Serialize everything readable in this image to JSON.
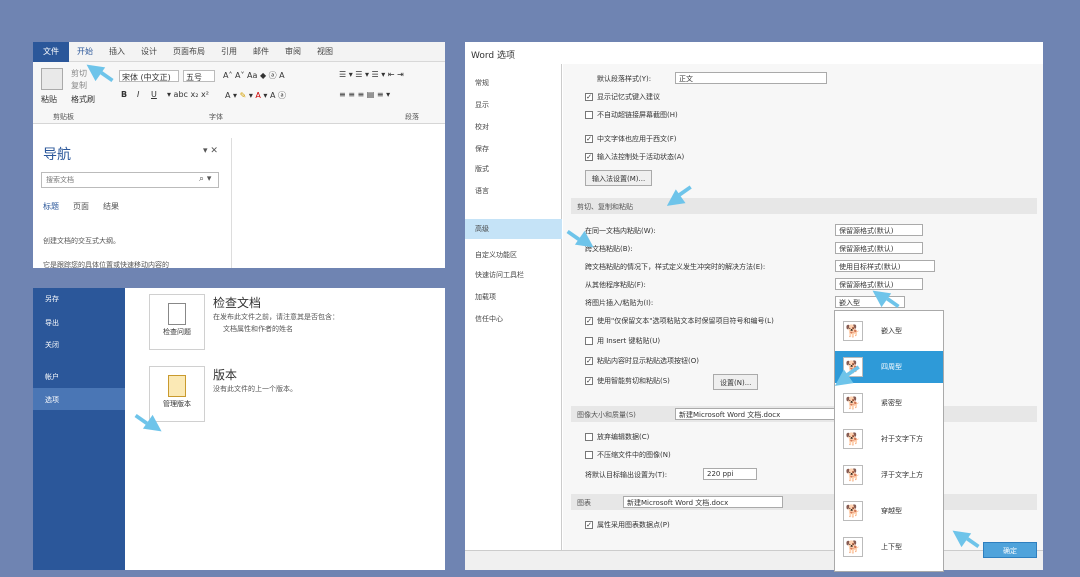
{
  "ribbon": {
    "tabs": [
      "文件",
      "开始",
      "插入",
      "设计",
      "页面布局",
      "引用",
      "邮件",
      "审阅",
      "视图"
    ],
    "paste": "粘贴",
    "cut": "剪切",
    "copy": "复制",
    "format_painter": "格式刷",
    "font_name": "宋体 (中文正)",
    "font_size": "五号",
    "groups": [
      "剪贴板",
      "字体",
      "段落"
    ]
  },
  "nav": {
    "title": "导航",
    "search_placeholder": "搜索文档",
    "tabs": [
      "标题",
      "页面",
      "结果"
    ],
    "text1": "创建文档的交互式大纲。",
    "text2": "它是跟踪您的具体位置或快速移动内容的"
  },
  "backstage": {
    "items": [
      "另存",
      "导出",
      "关闭",
      "帐户",
      "选项"
    ],
    "check_card": "检查问题",
    "check_title": "检查文档",
    "check_desc1": "在发布此文件之前，请注意其是否包含：",
    "check_desc2": "文档属性和作者的姓名",
    "version_card": "管理版本",
    "version_title": "版本",
    "version_desc": "没有此文件的上一个版本。"
  },
  "options": {
    "title": "Word 选项",
    "sidebar": [
      "常规",
      "显示",
      "校对",
      "保存",
      "版式",
      "语言",
      "高级",
      "自定义功能区",
      "快速访问工具栏",
      "加载项",
      "信任中心"
    ],
    "default_para_label": "默认段落样式(Y):",
    "default_para_value": "正文",
    "checks_top": [
      "显示记忆式键入建议",
      "不自动超链接屏幕截图(H)",
      "中文字体也应用于西文(F)",
      "输入法控制处于活动状态(A)"
    ],
    "ime_button": "输入法设置(M)...",
    "section_paste": "剪切、复制和粘贴",
    "paste_rows": [
      "在同一文档内粘贴(W):",
      "跨文档粘贴(B):",
      "跨文档粘贴的情况下，样式定义发生冲突时的解决方法(E):",
      "从其他程序粘贴(F):",
      "将图片插入/粘贴为(I):"
    ],
    "paste_values": [
      "保留源格式(默认)",
      "保留源格式(默认)",
      "使用目标样式(默认)",
      "保留源格式(默认)",
      "嵌入型"
    ],
    "paste_checks": [
      "使用\"仅保留文本\"选项粘贴文本时保留项目符号和编号(L)",
      "用 Insert 键粘贴(U)",
      "粘贴内容时显示粘贴选项按钮(O)",
      "使用智能剪切和粘贴(S)"
    ],
    "settings_button": "设置(N)...",
    "section_image": "图像大小和质量(S)",
    "image_doc": "新建Microsoft Word 文档.docx",
    "image_checks": [
      "放弃编辑数据(C)",
      "不压缩文件中的图像(N)"
    ],
    "resolution_label": "将默认目标输出设置为(T):",
    "resolution_value": "220 ppi",
    "section_chart": "图表",
    "chart_doc": "新建Microsoft Word 文档.docx",
    "chart_check": "属性采用图表数据点(P)",
    "ok_button": "确定"
  },
  "wrap_menu": {
    "items": [
      "嵌入型",
      "四周型",
      "紧密型",
      "衬于文字下方",
      "浮于文字上方",
      "穿越型",
      "上下型"
    ],
    "selected": "四周型"
  },
  "colors": {
    "accent": "#2b579a",
    "arrow": "#6ec4ea",
    "highlight": "#2e9ad8",
    "background": "#6f84b2"
  }
}
